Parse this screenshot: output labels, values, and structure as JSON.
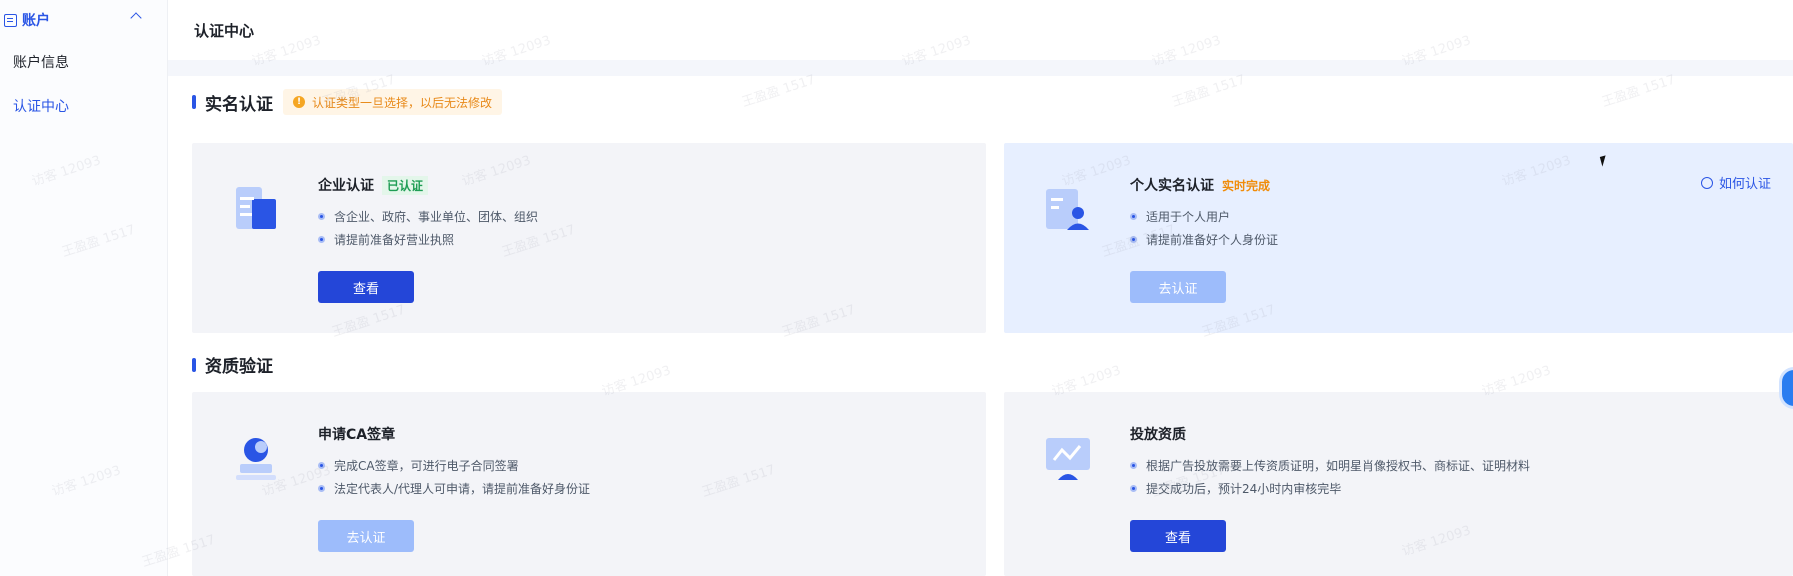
{
  "sidebar": {
    "group_label": "账户",
    "items": [
      {
        "label": "账户信息",
        "active": false
      },
      {
        "label": "认证中心",
        "active": true
      }
    ]
  },
  "header": {
    "title": "认证中心"
  },
  "realname_section": {
    "title": "实名认证",
    "notice": "认证类型一旦选择，以后无法修改",
    "cards": [
      {
        "title": "企业认证",
        "tag": "已认证",
        "bullets": [
          "含企业、政府、事业单位、团体、组织",
          "请提前准备好营业执照"
        ],
        "button": "查看",
        "icon": "enterprise-building-icon"
      },
      {
        "title": "个人实名认证",
        "tag": "实时完成",
        "bullets": [
          "适用于个人用户",
          "请提前准备好个人身份证"
        ],
        "button": "去认证",
        "help_link": "如何认证",
        "icon": "personal-id-icon"
      }
    ]
  },
  "qualification_section": {
    "title": "资质验证",
    "cards": [
      {
        "title": "申请CA签章",
        "bullets": [
          "完成CA签章，可进行电子合同签署",
          "法定代表人/代理人可申请，请提前准备好身份证"
        ],
        "button": "去认证",
        "icon": "seal-stamp-icon"
      },
      {
        "title": "投放资质",
        "bullets": [
          "根据广告投放需要上传资质证明，如明星肖像授权书、商标证、证明材料",
          "提交成功后，预计24小时内审核完毕"
        ],
        "button": "查看",
        "icon": "ad-monitor-icon"
      }
    ]
  },
  "watermark_texts": [
    "访客 12093",
    "王盈盈 1517"
  ],
  "colors": {
    "accent": "#2a55e5",
    "primary_button": "#2446d8",
    "disabled_button": "#9dbcfb",
    "notice": "#e88a1a",
    "success": "#1f9d55"
  }
}
